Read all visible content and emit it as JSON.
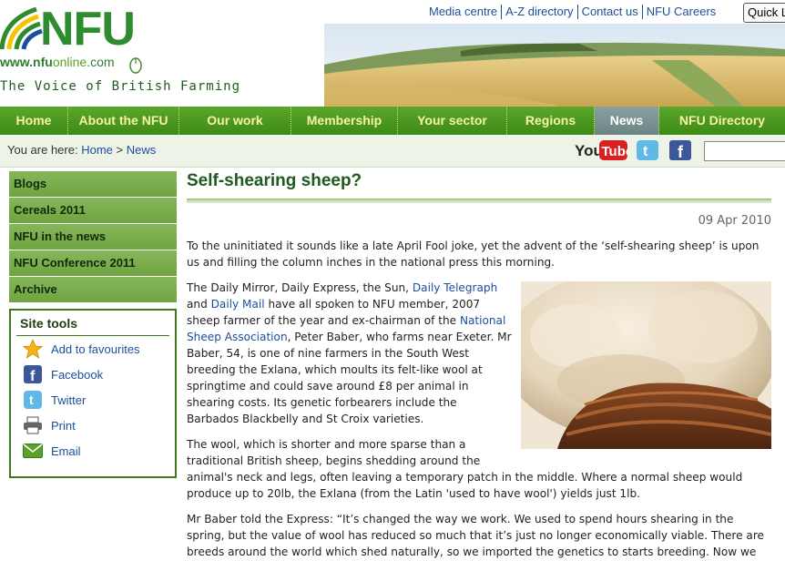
{
  "header": {
    "logo_text": "NFU",
    "logo_url_prefix": "www.nfu",
    "logo_url_mid": "online",
    "logo_url_suffix": ".com",
    "tagline": "The Voice of British Farming",
    "brand_colors": {
      "green": "#2e8b2e",
      "nav_green": "#4b9a22",
      "link_blue": "#1b4f9c"
    }
  },
  "topnav": {
    "items": [
      "Media centre",
      "A-Z directory",
      "Contact us",
      "NFU Careers"
    ],
    "quick_label": "Quick L"
  },
  "mainnav": {
    "items": [
      "Home",
      "About the NFU",
      "Our work",
      "Membership",
      "Your sector",
      "Regions",
      "News",
      "NFU Directory"
    ],
    "active": "News"
  },
  "breadcrumb": {
    "prefix": "You are here:",
    "home": "Home",
    "separator": ">",
    "current": "News"
  },
  "social": {
    "youtube_you": "You",
    "youtube_tube": "Tube",
    "twitter_glyph": "t",
    "facebook_glyph": "f"
  },
  "sidebar": {
    "links": [
      "Blogs",
      "Cereals 2011",
      "NFU in the news",
      "NFU Conference 2011",
      "Archive"
    ],
    "tools_title": "Site tools",
    "tools": [
      {
        "label": "Add to favourites",
        "icon": "star-icon"
      },
      {
        "label": "Facebook",
        "icon": "facebook-icon"
      },
      {
        "label": "Twitter",
        "icon": "twitter-icon"
      },
      {
        "label": "Print",
        "icon": "printer-icon"
      },
      {
        "label": "Email",
        "icon": "email-icon"
      }
    ]
  },
  "article": {
    "title": "Self-shearing sheep?",
    "date": "09 Apr 2010",
    "p1": "To the uninitiated it sounds like a late April Fool joke, yet the advent of the ‘self-shearing sheep’ is upon us and filling the column inches in the national press this morning.",
    "p2_a": "The Daily Mirror, Daily Express, the Sun, ",
    "p2_link1": "Daily Telegraph",
    "p2_b": " and ",
    "p2_link2": "Daily Mail",
    "p2_c": " have all spoken to NFU member, 2007 sheep farmer of the year and ex-chairman of the ",
    "p2_link3": "National Sheep Association",
    "p2_d": ", Peter Baber, who farms near Exeter. Mr Baber, 54, is one of nine farmers in the South West breeding the Exlana, which moults its felt-like wool at springtime and could save around £8 per animal in shearing costs. Its genetic forbearers include the Barbados Blackbelly and St Croix varieties.",
    "p3": "The wool, which is shorter and more sparse than a traditional British sheep, begins shedding around the animal's neck and legs, often leaving a temporary patch in the middle. Where a normal sheep would produce up to 20lb, the Exlana (from the Latin 'used to have wool') yields just 1lb.",
    "p4": "Mr Baber told the Express: “It’s changed the way we work. We used to spend hours shearing in the spring, but the value of wool has reduced so much that it’s just no longer economically viable. There are breeds around the world which shed naturally, so we imported the genetics to starts breeding. Now we have"
  }
}
